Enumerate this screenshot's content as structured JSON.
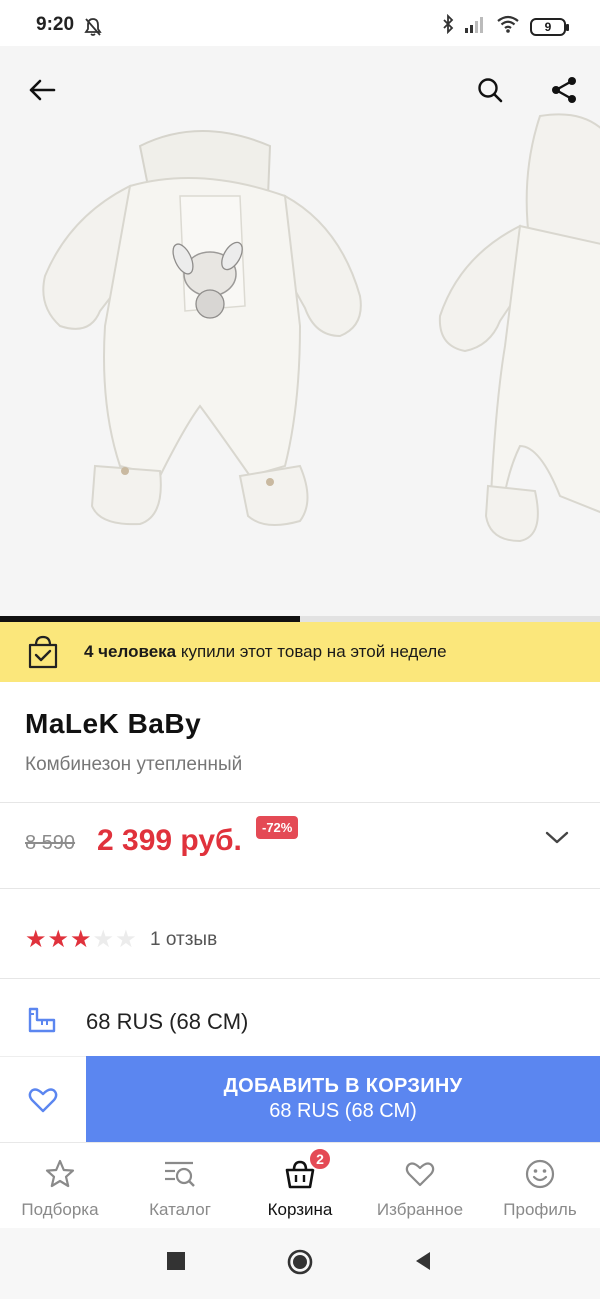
{
  "status_bar": {
    "time": "9:20",
    "battery": "9",
    "icons": [
      "mute-bell-icon",
      "bluetooth-icon",
      "signal-icon",
      "wifi-icon",
      "battery-icon"
    ]
  },
  "product_header": {
    "icons": [
      "back-arrow-icon",
      "search-icon",
      "share-icon"
    ],
    "gallery_progress": 0.5
  },
  "promo": {
    "bold_text": "4 человека",
    "text": " купили этот товар на этой неделе",
    "icon": "shopping-bag-check-icon"
  },
  "product": {
    "brand": "MaLeK BaBy",
    "subtitle": "Комбинезон утепленный",
    "price_old": "8 590",
    "price_new": "2 399 руб.",
    "discount": "-72%",
    "rating": 3,
    "rating_max": 5,
    "reviews": "1 отзыв",
    "size": "68 RUS (68 СМ)"
  },
  "action_bar": {
    "add_to_cart_label": "ДОБАВИТЬ В КОРЗИНУ",
    "add_to_cart_sub": "68 RUS (68 СМ)"
  },
  "bottom_nav": {
    "tabs": [
      {
        "label": "Подборка",
        "icon": "star-outline-icon"
      },
      {
        "label": "Каталог",
        "icon": "catalog-search-icon"
      },
      {
        "label": "Корзина",
        "icon": "basket-icon",
        "badge": "2",
        "active": true
      },
      {
        "label": "Избранное",
        "icon": "heart-outline-icon"
      },
      {
        "label": "Профиль",
        "icon": "smiley-icon"
      }
    ]
  },
  "colors": {
    "accent_blue": "#5b86f0",
    "price_red": "#e0323c",
    "promo_yellow": "#fbe77b",
    "star_red": "#e0323c"
  }
}
